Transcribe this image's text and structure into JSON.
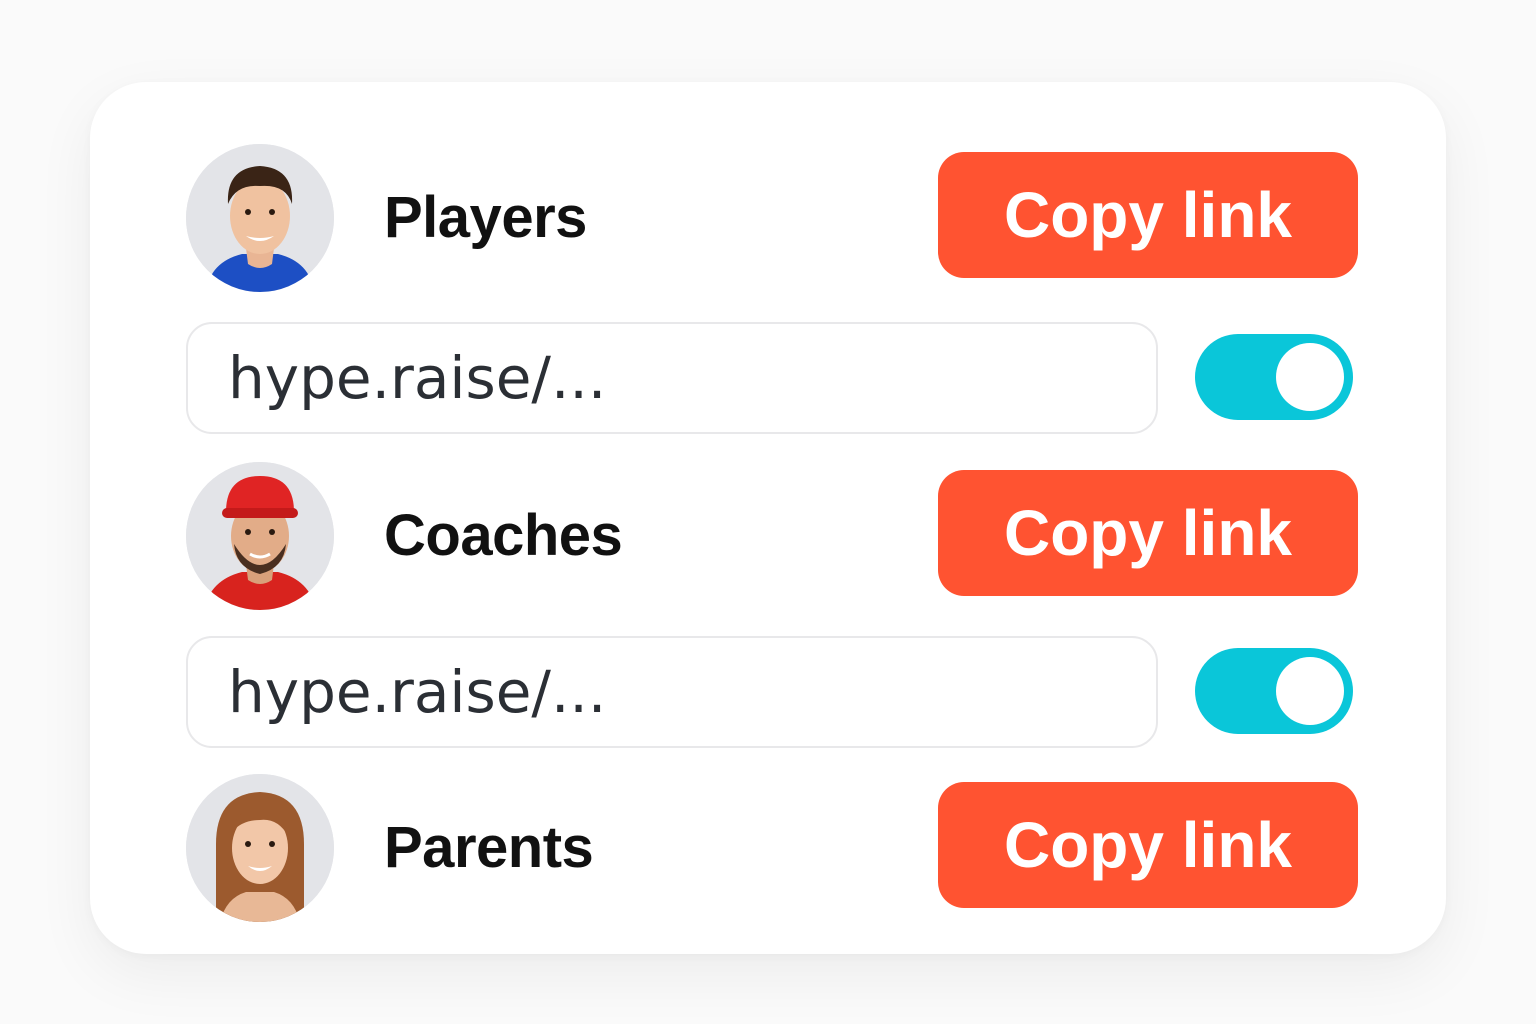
{
  "groups": [
    {
      "label": "Players",
      "button_label": "Copy link",
      "avatar": "player-avatar",
      "link": {
        "value": "hype.raise/...",
        "toggle_on": true
      }
    },
    {
      "label": "Coaches",
      "button_label": "Copy link",
      "avatar": "coach-avatar",
      "link": {
        "value": "hype.raise/...",
        "toggle_on": true
      }
    },
    {
      "label": "Parents",
      "button_label": "Copy link",
      "avatar": "parent-avatar"
    }
  ],
  "colors": {
    "button": "#ff5331",
    "toggle_on": "#0ac6d9",
    "card": "#ffffff",
    "background": "#fafafa"
  }
}
